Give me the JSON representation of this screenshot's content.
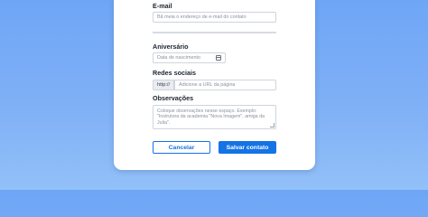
{
  "form": {
    "email": {
      "label": "E-mail",
      "placeholder": "Bã meia o endereço de e-mail do contato"
    },
    "birthday": {
      "label": "Aniversário",
      "placeholder": "Data de nascimento",
      "icon": "calendar-icon"
    },
    "social": {
      "label": "Redes sociais",
      "prefix": "http://",
      "placeholder": "Adicione a URL da página"
    },
    "notes": {
      "label": "Observações",
      "placeholder": "Coloque observações nesse espaço. Exemplo: \"Instrutora da academia \"Nova Imagem\", amiga da Julia\"."
    },
    "buttons": {
      "cancel": "Cancelar",
      "save": "Salvar contato"
    }
  },
  "colors": {
    "accent": "#1473e6",
    "background": "#7fb0f6"
  }
}
